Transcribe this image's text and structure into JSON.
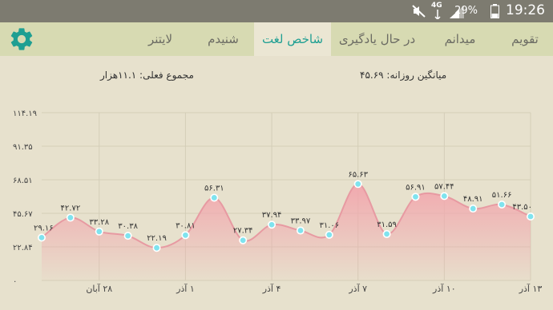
{
  "status": {
    "network": "4G",
    "battery": "29%",
    "time": "19:26"
  },
  "tabs": [
    {
      "label": "تقویم",
      "active": false
    },
    {
      "label": "میدانم",
      "active": false
    },
    {
      "label": "در حال یادگیری",
      "active": false
    },
    {
      "label": "شاخص لغت",
      "active": true
    },
    {
      "label": "شنیدم",
      "active": false
    },
    {
      "label": "لایتنر",
      "active": false
    }
  ],
  "settings_icon": "gear-icon",
  "colors": {
    "accent": "#1e9f92",
    "area_fill": "#f2a6ad",
    "line": "#e79aa2",
    "point": "#7fe3ee",
    "background": "#e7e1cd",
    "tabbar": "#d7dab2"
  },
  "summary": {
    "daily_avg": "میانگین روزانه: ۴۵.۶۹",
    "total": "مجموع فعلی: ۱۱.۱هزار"
  },
  "chart_data": {
    "type": "area",
    "y_ticks": [
      "۱۱۴.۱۹",
      "۹۱.۳۵",
      "۶۸.۵۱",
      "۴۵.۶۷",
      "۲۲.۸۴",
      "۰"
    ],
    "ylim": [
      0,
      114.19
    ],
    "x_ticks": [
      "۲۸ آبان",
      "۱ آذر",
      "۴ آذر",
      "۷ آذر",
      "۱۰ آذر",
      "۱۳ آذر"
    ],
    "grid": true,
    "points": [
      {
        "value": 29.16,
        "label": "۲۹.۱۶"
      },
      {
        "value": 42.72,
        "label": "۴۲.۷۲"
      },
      {
        "value": 33.28,
        "label": "۳۳.۲۸"
      },
      {
        "value": 30.38,
        "label": "۳۰.۳۸"
      },
      {
        "value": 22.19,
        "label": "۲۲.۱۹"
      },
      {
        "value": 30.81,
        "label": "۳۰.۸۱"
      },
      {
        "value": 56.31,
        "label": "۵۶.۳۱"
      },
      {
        "value": 27.34,
        "label": "۲۷.۳۴"
      },
      {
        "value": 37.94,
        "label": "۳۷.۹۴"
      },
      {
        "value": 33.97,
        "label": "۳۳.۹۷"
      },
      {
        "value": 31.06,
        "label": "۳۱.۰۶"
      },
      {
        "value": 65.63,
        "label": "۶۵.۶۳"
      },
      {
        "value": 31.59,
        "label": "۳۱.۵۹"
      },
      {
        "value": 56.91,
        "label": "۵۶.۹۱"
      },
      {
        "value": 57.44,
        "label": "۵۷.۴۴"
      },
      {
        "value": 48.91,
        "label": "۴۸.۹۱"
      },
      {
        "value": 51.66,
        "label": "۵۱.۶۶"
      },
      {
        "value": 43.5,
        "label": "۴۳.۵۰"
      }
    ]
  }
}
